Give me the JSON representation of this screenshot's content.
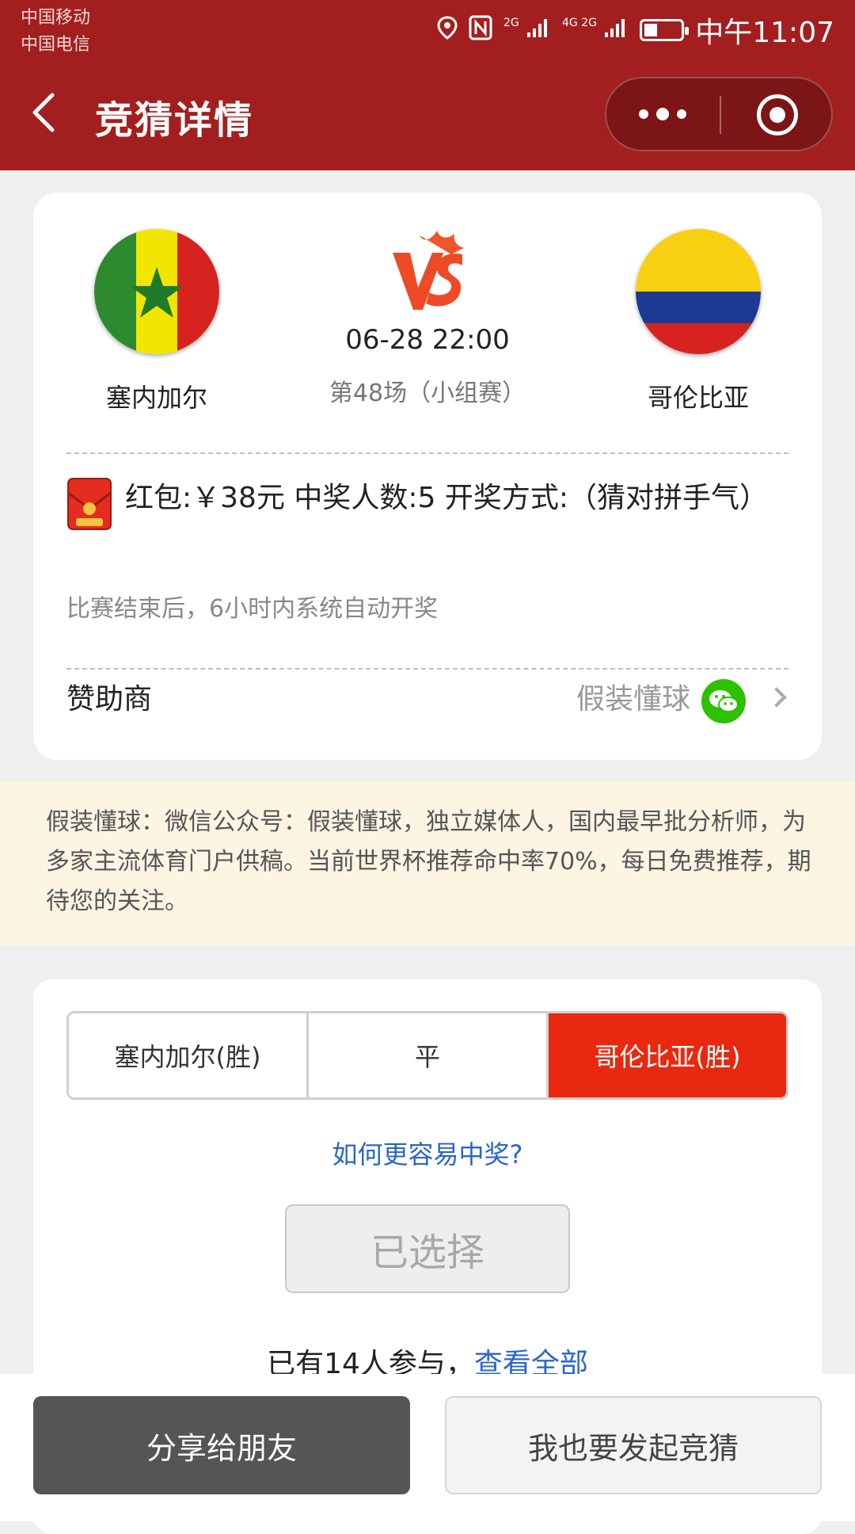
{
  "status_bar": {
    "carrier_1": "中国移动",
    "carrier_2": "中国电信",
    "signal_1": "2G",
    "signal_2": "4G 2G",
    "time": "中午11:07"
  },
  "nav": {
    "title": "竞猜详情"
  },
  "match": {
    "home_team": "塞内加尔",
    "away_team": "哥伦比亚",
    "datetime": "06-28 22:00",
    "round": "第48场（小组赛）"
  },
  "prize": {
    "text": "红包:￥38元 中奖人数:5 开奖方式:（猜对拼手气）",
    "note": "比赛结束后，6小时内系统自动开奖"
  },
  "sponsor": {
    "label": "赞助商",
    "name": "假装懂球"
  },
  "banner": {
    "text": "假装懂球：微信公众号：假装懂球，独立媒体人，国内最早批分析师，为多家主流体育门户供稿。当前世界杯推荐命中率70%，每日免费推荐，期待您的关注。"
  },
  "bet": {
    "options": [
      "塞内加尔(胜)",
      "平",
      "哥伦比亚(胜)"
    ],
    "selected_option": "哥伦比亚(胜)",
    "howto_link": "如何更容易中奖?",
    "chosen_label": "已选择",
    "participants_prefix": "已有14人参与，",
    "view_all": "查看全部"
  },
  "bottom": {
    "share": "分享给朋友",
    "start": "我也要发起竞猜"
  },
  "colors": {
    "header": "#a31f1f",
    "selected": "#e8290f",
    "link": "#2a66c8",
    "banner_bg": "#fdf4e4"
  }
}
